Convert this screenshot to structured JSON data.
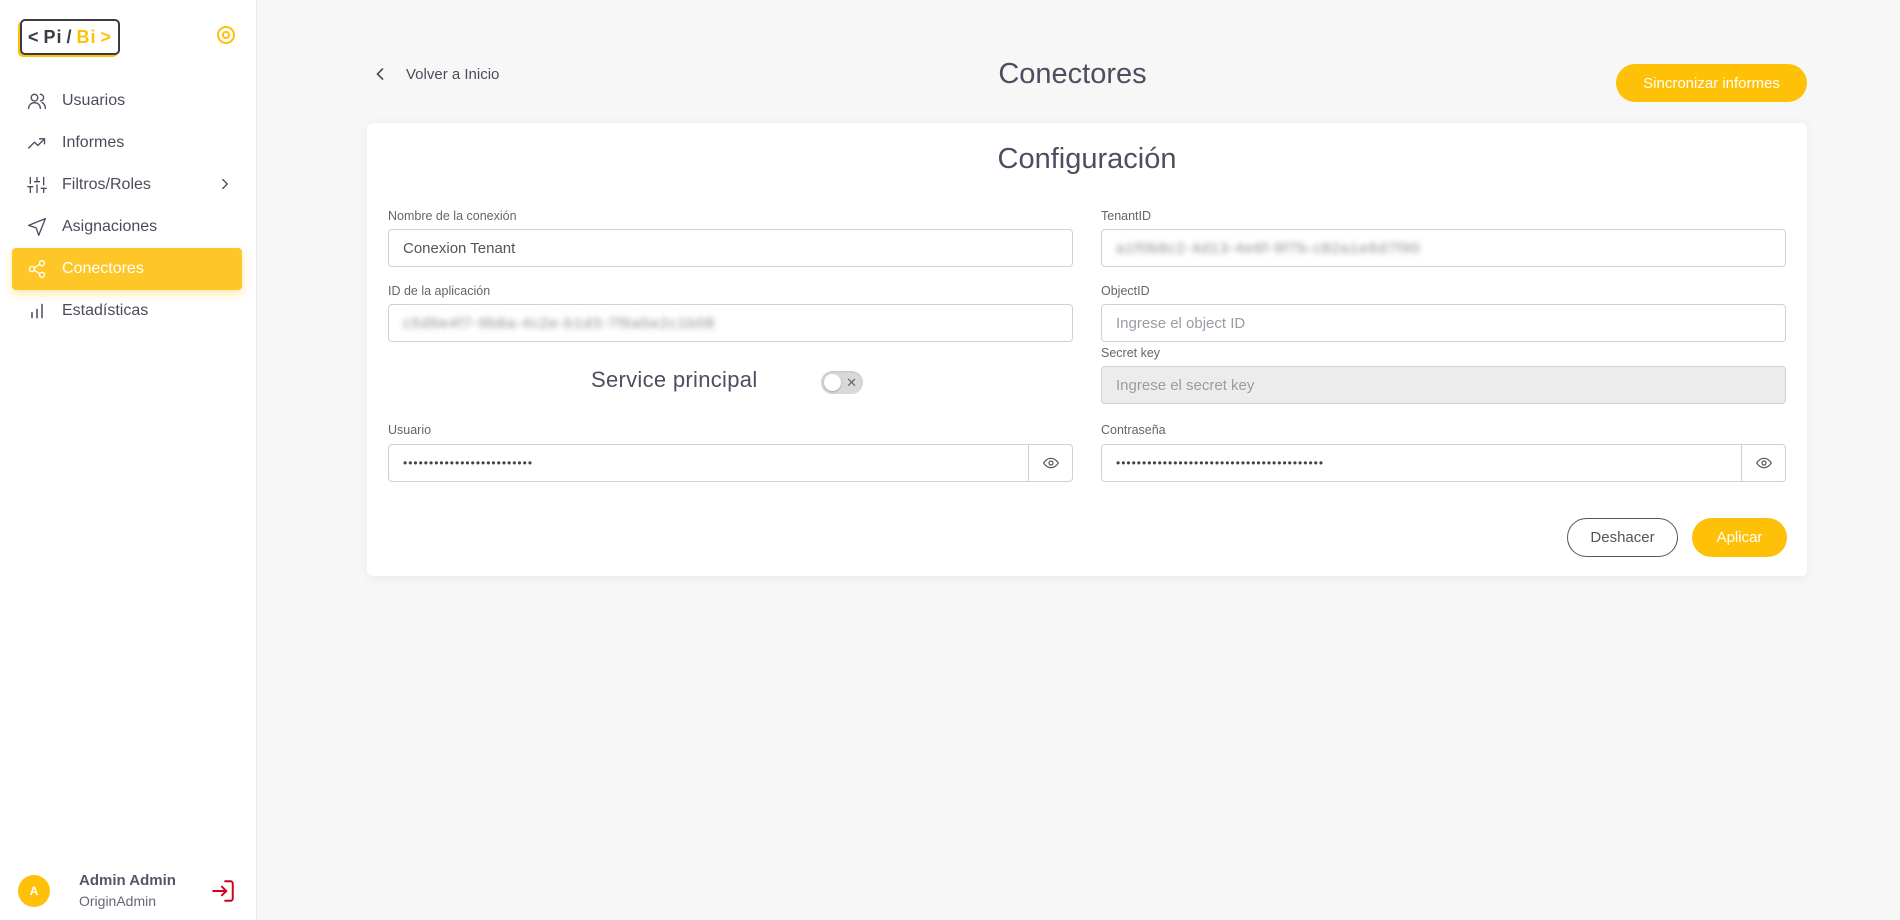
{
  "logo": {
    "lt": "<",
    "pi": "Pi",
    "slash": "/",
    "bi": "Bi",
    "gt": ">"
  },
  "sidebar": {
    "items": [
      {
        "label": "Usuarios",
        "icon": "users-icon"
      },
      {
        "label": "Informes",
        "icon": "trending-up-icon"
      },
      {
        "label": "Filtros/Roles",
        "icon": "sliders-icon"
      },
      {
        "label": "Asignaciones",
        "icon": "send-icon"
      },
      {
        "label": "Conectores",
        "icon": "share-icon",
        "active": true
      },
      {
        "label": "Estadísticas",
        "icon": "bar-chart-icon"
      }
    ]
  },
  "user": {
    "initial": "A",
    "name": "Admin Admin",
    "role": "OriginAdmin"
  },
  "header": {
    "back_label": "Volver a Inicio",
    "title": "Conectores",
    "sync_label": "Sincronizar informes"
  },
  "config": {
    "title": "Configuración",
    "connection_name": {
      "label": "Nombre de la conexión",
      "value": "Conexion Tenant"
    },
    "tenant_id": {
      "label": "TenantID",
      "value": "a1f0b8c2-4d13-4e6f-9f7b-c82a1e6d7f90"
    },
    "app_id": {
      "label": "ID de la aplicación",
      "value": "c5d9e4f7-9b8a-4c2e-b1d3-7f6a5e2c1b08"
    },
    "object_id": {
      "label": "ObjectID",
      "placeholder": "Ingrese el object ID"
    },
    "secret_key": {
      "label": "Secret key",
      "placeholder": "Ingrese el secret key"
    },
    "service_principal": {
      "label": "Service principal",
      "enabled": false,
      "off_mark": "✕"
    },
    "usuario": {
      "label": "Usuario",
      "value": "•••••••••••••••••••••••••"
    },
    "password": {
      "label": "Contraseña",
      "value": "••••••••••••••••••••••••••••••••••••••••"
    },
    "undo_label": "Deshacer",
    "apply_label": "Aplicar"
  },
  "colors": {
    "accent": "#ffc107",
    "text": "#4d4f60",
    "logout": "#d0021b"
  }
}
